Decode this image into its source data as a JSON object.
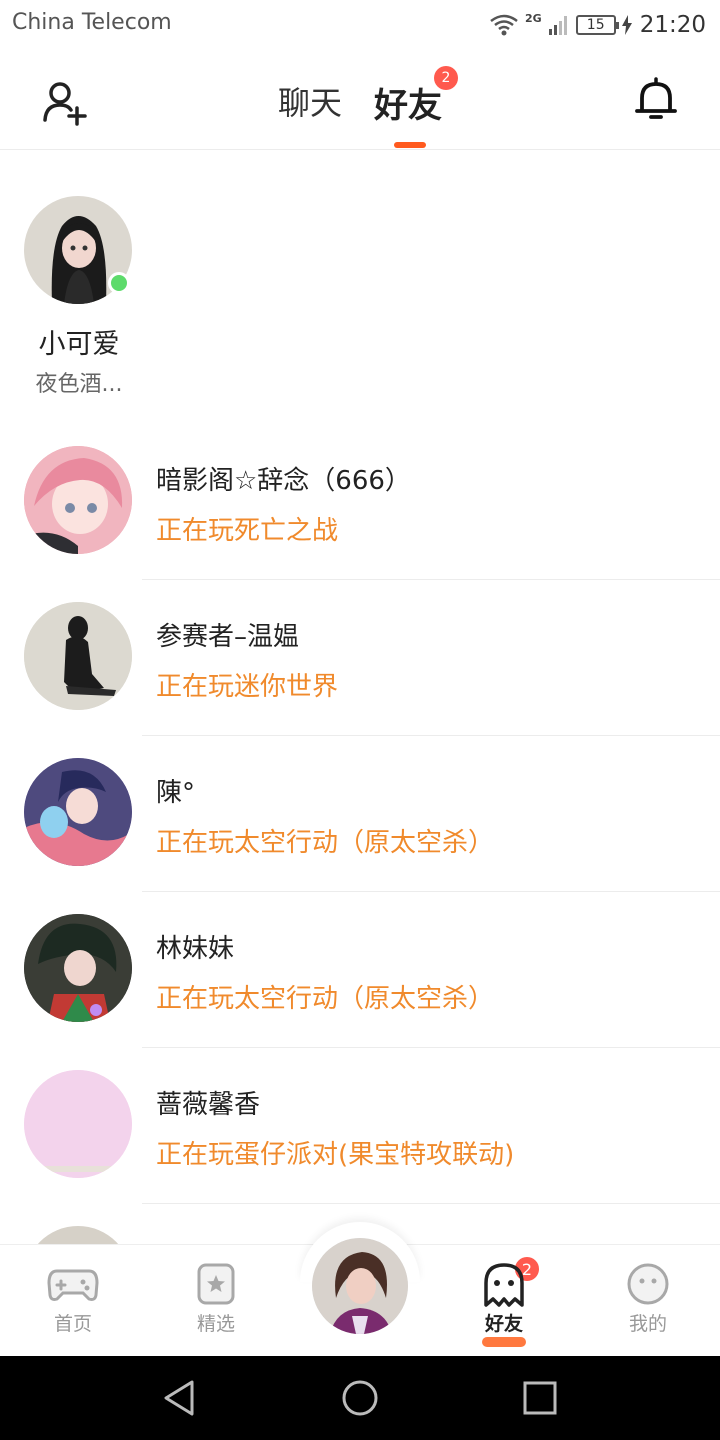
{
  "status_bar": {
    "carrier": "China Telecom",
    "network": "2G",
    "battery": "15",
    "time": "21:20"
  },
  "header": {
    "tabs": [
      {
        "label": "聊天",
        "active": false
      },
      {
        "label": "好友",
        "active": true,
        "badge": "2"
      }
    ],
    "left_icon": "add-friend-icon",
    "right_icon": "bell-icon"
  },
  "featured_friend": {
    "name": "小可爱",
    "status": "夜色酒...",
    "online": true
  },
  "friends": [
    {
      "name": "暗影阁☆辞念（666）",
      "status": "正在玩死亡之战",
      "avatar_color": "#e9a3ad"
    },
    {
      "name": "参赛者–温媪",
      "status": "正在玩迷你世界",
      "avatar_color": "#d9d6cd"
    },
    {
      "name": "陳°",
      "status": "正在玩太空行动（原太空杀）",
      "avatar_color": "#6a5f9a"
    },
    {
      "name": "林妹妹",
      "status": "正在玩太空行动（原太空杀）",
      "avatar_color": "#2b2b2b"
    },
    {
      "name": "蔷薇馨香",
      "status": "正在玩蛋仔派对(果宝特攻联动)",
      "avatar_color": "#f3d3ec"
    }
  ],
  "bottom_nav": {
    "items": [
      {
        "label": "首页",
        "icon": "gamepad-icon"
      },
      {
        "label": "精选",
        "icon": "star-bookmark-icon"
      },
      {
        "label": "好友",
        "icon": "ghost-icon",
        "badge": "2",
        "active": true
      },
      {
        "label": "我的",
        "icon": "face-icon"
      }
    ]
  },
  "colors": {
    "accent": "#ff5a1e",
    "status_orange": "#f08a2c",
    "badge_red": "#ff5a4e",
    "online_green": "#5ddb6b"
  }
}
